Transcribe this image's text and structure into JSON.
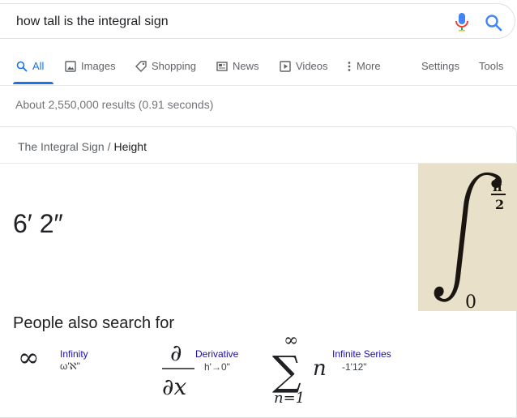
{
  "search": {
    "query": "how tall is the integral sign"
  },
  "tabs": [
    {
      "label": "All",
      "icon": "search-icon",
      "active": true
    },
    {
      "label": "Images",
      "icon": "image-icon"
    },
    {
      "label": "Shopping",
      "icon": "tag-icon"
    },
    {
      "label": "News",
      "icon": "news-icon"
    },
    {
      "label": "Videos",
      "icon": "play-icon"
    },
    {
      "label": "More",
      "icon": "more-vert-icon"
    }
  ],
  "tools": {
    "settings": "Settings",
    "tools": "Tools"
  },
  "result_stats": "About 2,550,000 results (0.91 seconds)",
  "card": {
    "breadcrumb_parent": "The Integral Sign",
    "breadcrumb_sep": "/",
    "breadcrumb_current": "Height",
    "answer": "6′ 2″",
    "image_upper_limit": "π/2",
    "image_lower_limit": "0"
  },
  "people_also_search": {
    "title": "People also search for",
    "items": [
      {
        "name": "Infinity",
        "sub": "ω'ℵ\""
      },
      {
        "name": "Derivative",
        "sub": "h'→0\""
      },
      {
        "name": "Infinite Series",
        "sub": "-1'12\""
      }
    ]
  },
  "colors": {
    "accent": "#1a73e8",
    "link": "#1a0dab",
    "muted": "#70757a"
  }
}
